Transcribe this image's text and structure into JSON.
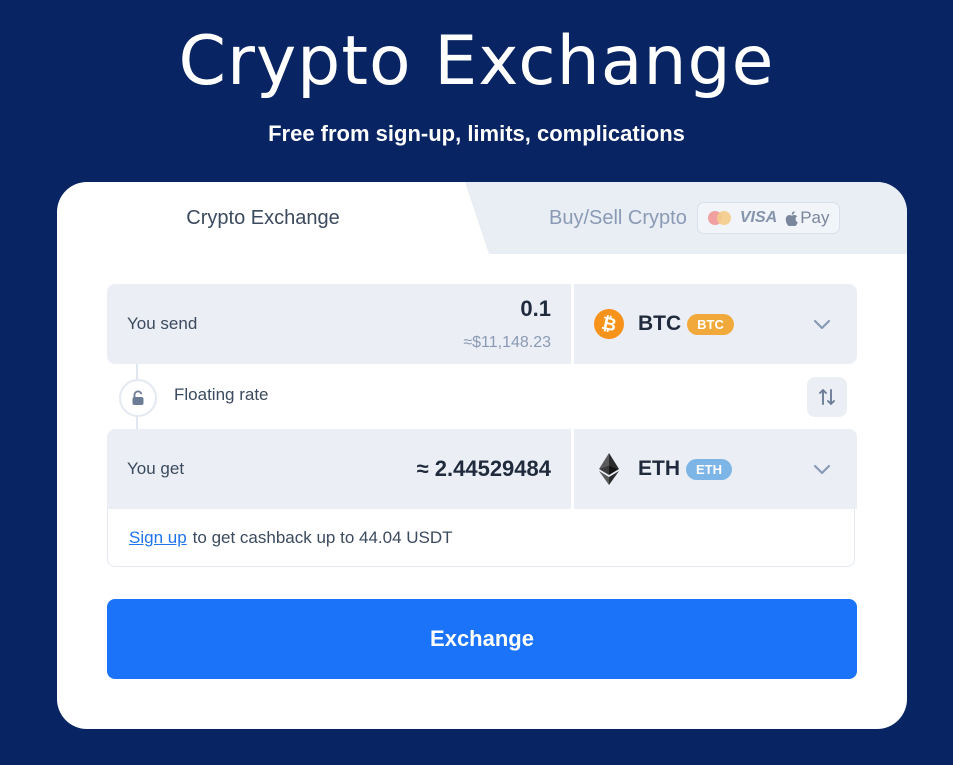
{
  "hero": {
    "title": "Crypto Exchange",
    "subtitle": "Free from sign-up, limits, complications"
  },
  "tabs": {
    "exchange_label": "Crypto Exchange",
    "buy_sell_label": "Buy/Sell Crypto",
    "active": "Crypto Exchange",
    "payment_badges": {
      "mastercard_icon": "mastercard-icon",
      "visa_label": "VISA",
      "apple_pay_label": "Pay"
    }
  },
  "send": {
    "label": "You send",
    "amount": "0.1",
    "usd_value": "≈$11,148.23",
    "coin_code": "BTC",
    "coin_badge": "BTC",
    "coin_color": "#f7931a",
    "badge_color": "#f1a93b"
  },
  "rate": {
    "label": "Floating rate",
    "lock_icon": "lock-icon",
    "swap_icon": "swap-icon"
  },
  "get": {
    "label": "You get",
    "amount": "≈ 2.44529484",
    "coin_code": "ETH",
    "coin_badge": "ETH",
    "badge_color": "#7db6e6"
  },
  "promo": {
    "link_text": "Sign up",
    "text": "to get cashback up to 44.04 USDT"
  },
  "actions": {
    "exchange_label": "Exchange",
    "accent": "#1a73f8"
  },
  "colors": {
    "background": "#082463",
    "card": "#ffffff",
    "field": "#ebeff5"
  }
}
